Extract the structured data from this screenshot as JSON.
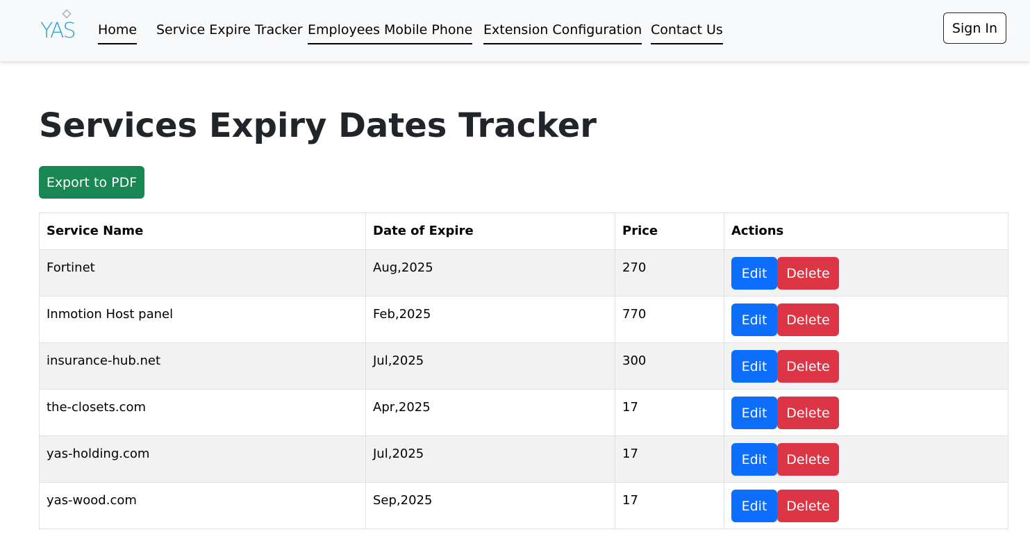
{
  "nav": {
    "logo_text": "YAS",
    "links": [
      {
        "label": "Home",
        "underlined": true
      },
      {
        "label": "Service Expire Tracker",
        "underlined": false
      },
      {
        "label": "Employees Mobile Phone",
        "underlined": true
      },
      {
        "label": "Extension Configuration",
        "underlined": true
      },
      {
        "label": "Contact Us",
        "underlined": true
      }
    ],
    "signin_label": "Sign In"
  },
  "main": {
    "title": "Services Expiry Dates Tracker",
    "export_label": "Export to PDF"
  },
  "table": {
    "columns": [
      "Service Name",
      "Date of Expire",
      "Price",
      "Actions"
    ],
    "rows": [
      {
        "name": "Fortinet",
        "date": "Aug,2025",
        "price": "270"
      },
      {
        "name": "Inmotion Host panel",
        "date": "Feb,2025",
        "price": "770"
      },
      {
        "name": "insurance-hub.net",
        "date": "Jul,2025",
        "price": "300"
      },
      {
        "name": "the-closets.com",
        "date": "Apr,2025",
        "price": "17"
      },
      {
        "name": "yas-holding.com",
        "date": "Jul,2025",
        "price": "17"
      },
      {
        "name": "yas-wood.com",
        "date": "Sep,2025",
        "price": "17"
      }
    ],
    "edit_label": "Edit",
    "delete_label": "Delete"
  },
  "colors": {
    "navbar_bg": "#f8f9fa",
    "export_green": "#198754",
    "edit_blue": "#0d6efd",
    "delete_red": "#dc3545",
    "logo_teal": "#2aa3c9"
  }
}
